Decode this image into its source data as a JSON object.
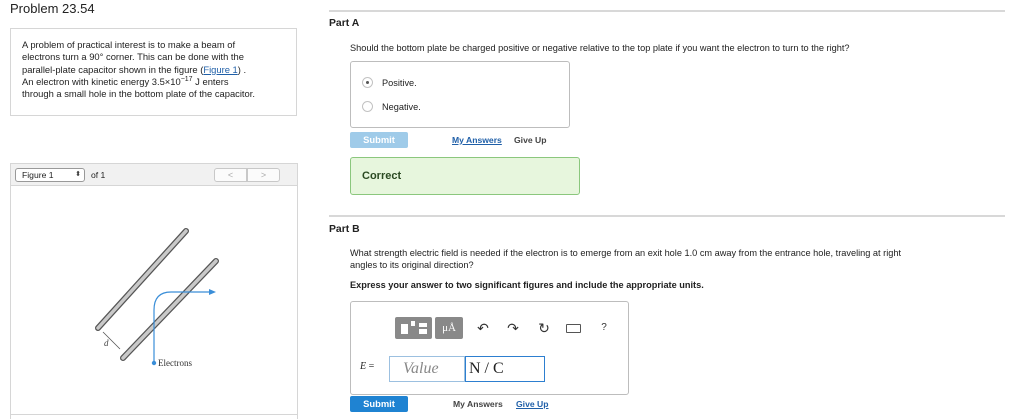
{
  "problem": {
    "title": "Problem 23.54"
  },
  "statement": {
    "line1": "A problem of practical interest is to make a beam of",
    "line2": "electrons turn a 90° corner. This can be done with the",
    "line3_pre": "parallel-plate capacitor shown in the figure (",
    "figure_link": "Figure 1",
    "line3_post": ") .",
    "line4_pre": "An electron with kinetic energy 3.5×10",
    "line4_exp": "−17",
    "line4_post": " J enters",
    "line5": "through a small hole in the bottom plate of the capacitor."
  },
  "figure": {
    "selector": "Figure 1",
    "of_label": "of 1",
    "prev_glyph": "<",
    "next_glyph": ">",
    "label_d": "d",
    "label_electrons": "Electrons"
  },
  "part_a": {
    "label": "Part A",
    "question": "Should the bottom plate be charged positive or negative relative to the top plate if you want the electron to turn to the right?",
    "options": [
      {
        "label": "Positive.",
        "selected": true
      },
      {
        "label": "Negative.",
        "selected": false
      }
    ],
    "submit": "Submit",
    "my_answers": "My Answers",
    "give_up": "Give Up",
    "feedback": "Correct"
  },
  "part_b": {
    "label": "Part B",
    "question_line1": "What strength electric field is needed if the electron is to emerge from an exit hole 1.0 cm away from the entrance hole, traveling at right",
    "question_line2": "angles to its original direction?",
    "instruction": "Express your answer to two significant figures and include the appropriate units.",
    "toolbar": {
      "units_glyph": "μÅ",
      "undo_glyph": "↶",
      "redo_glyph": "↷",
      "reset_glyph": "↻",
      "help_glyph": "?"
    },
    "eq_var": "E",
    "eq_sign": " =",
    "value_placeholder": "Value",
    "units_value": "N / C",
    "submit": "Submit",
    "my_answers": "My Answers",
    "give_up": "Give Up"
  },
  "colors": {
    "accent": "#1f83d2",
    "link": "#1f5fa8",
    "correct_bg": "#e7f6dd",
    "correct_border": "#8bc77d",
    "figure_arrow": "#3a8ed8"
  }
}
